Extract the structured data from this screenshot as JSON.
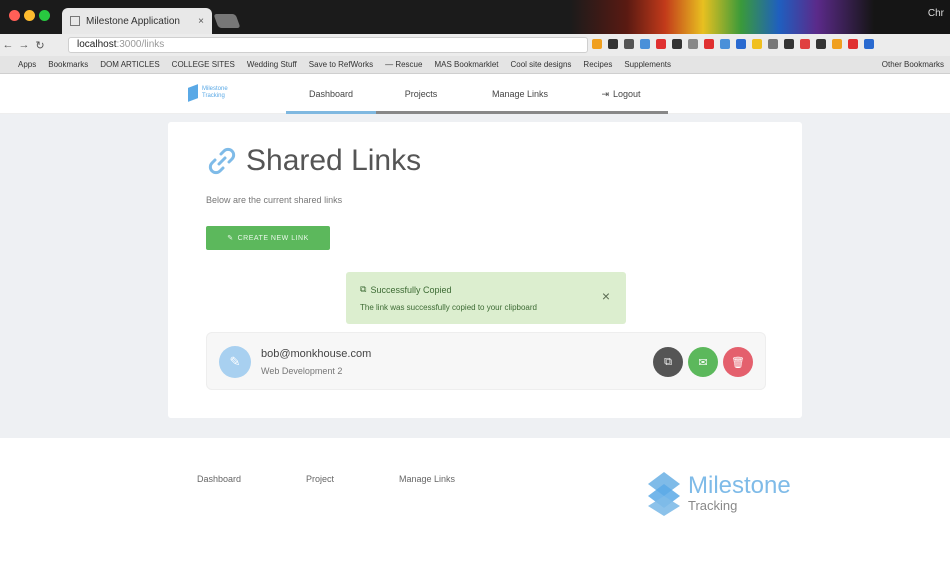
{
  "browser": {
    "tab_title": "Milestone Application",
    "tab_close": "×",
    "address_host": "localhost",
    "address_path": ":3000/links",
    "user_label": "Chr",
    "bookmarks": [
      "Apps",
      "Bookmarks",
      "DOM ARTICLES",
      "COLLEGE SITES",
      "Wedding Stuff",
      "Save to RefWorks",
      "— Rescue",
      "MAS Bookmarklet",
      "Cool site designs",
      "Recipes",
      "Supplements"
    ],
    "bookmarks_other": "Other Bookmarks"
  },
  "nav": {
    "logo_line1": "Milestone",
    "logo_line2": "Tracking",
    "items": [
      {
        "label": "Dashboard",
        "active": true
      },
      {
        "label": "Projects",
        "active": false
      },
      {
        "label": "Manage Links",
        "active": false
      },
      {
        "label": "Logout",
        "active": false
      }
    ],
    "logout_icon": "⇥"
  },
  "page": {
    "title": "Shared Links",
    "subtitle": "Below are the current shared links",
    "create_button": "CREATE NEW LINK",
    "create_icon": "✎"
  },
  "toast": {
    "title": "Successfully Copied",
    "message": "The link was successfully copied to your clipboard",
    "close": "×",
    "icon": "⧉"
  },
  "links": [
    {
      "email": "bob@monkhouse.com",
      "project": "Web Development 2"
    }
  ],
  "row_icons": {
    "avatar": "✎",
    "copy": "⧉",
    "email": "✉",
    "delete": "🗑"
  },
  "footer": {
    "links": [
      "Dashboard",
      "Project",
      "Manage Links"
    ],
    "brand": "Milestone",
    "brand_sub": "Tracking"
  },
  "colors": {
    "accent": "#7fbbe8",
    "success": "#5cb85c",
    "danger": "#e4606d",
    "toast_bg": "#dceecf"
  }
}
